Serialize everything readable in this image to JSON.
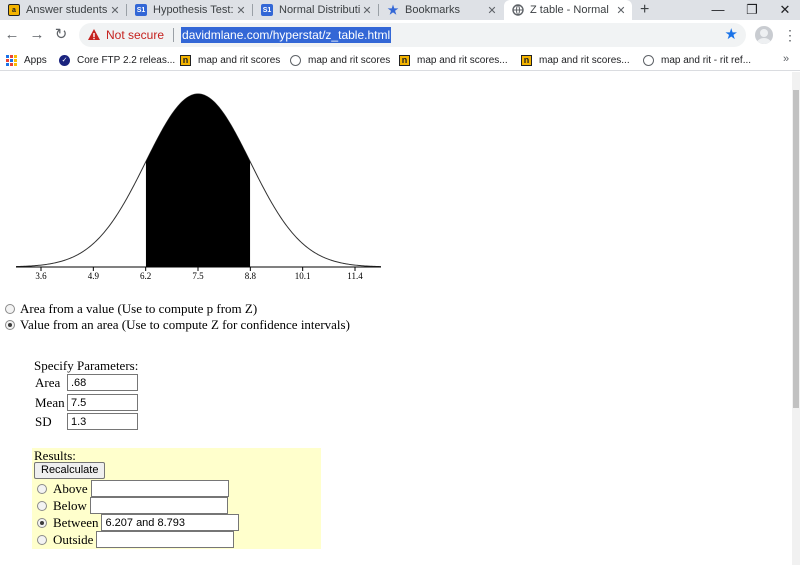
{
  "tabs": [
    {
      "label": "Answer students'",
      "favicon": "answer-favicon",
      "active": false
    },
    {
      "label": "Hypothesis Test: D",
      "favicon": "st-favicon",
      "active": false
    },
    {
      "label": "Normal Distributi",
      "favicon": "st-favicon",
      "active": false
    },
    {
      "label": "Bookmarks",
      "favicon": "star-favicon",
      "active": false
    },
    {
      "label": "Z table - Normal",
      "favicon": "globe-favicon",
      "active": true
    }
  ],
  "toolbar": {
    "security_label": "Not secure",
    "url": "davidmlane.com/hyperstat/z_table.html"
  },
  "bookmarks": [
    {
      "label": "Apps",
      "icon": "apps-icon"
    },
    {
      "label": "Core FTP 2.2 releas...",
      "icon": "ftp-icon"
    },
    {
      "label": "map and rit scores",
      "icon": "n-icon"
    },
    {
      "label": "map and rit scores",
      "icon": "globe-icon"
    },
    {
      "label": "map and rit scores...",
      "icon": "n-icon"
    },
    {
      "label": "map and rit scores...",
      "icon": "n-icon"
    },
    {
      "label": "map and rit - rit ref...",
      "icon": "globe-icon"
    }
  ],
  "chart_data": {
    "type": "area",
    "distribution": "normal",
    "mean": 7.5,
    "sd": 1.3,
    "shaded_region": [
      6.207,
      8.793
    ],
    "x_ticks": [
      "3.6",
      "4.9",
      "6.2",
      "7.5",
      "8.8",
      "10.1",
      "11.4"
    ],
    "x_tick_values": [
      3.6,
      4.9,
      6.2,
      7.5,
      8.8,
      10.1,
      11.4
    ],
    "xlim": [
      3.3,
      12.0
    ],
    "title": "",
    "xlabel": "",
    "ylabel": ""
  },
  "mode": {
    "options": [
      {
        "label": "Area from a value (Use to compute p from Z)",
        "checked": false
      },
      {
        "label": "Value from an area (Use to compute Z for confidence intervals)",
        "checked": true
      }
    ]
  },
  "parameters": {
    "heading": "Specify Parameters:",
    "area_label": "Area",
    "area_value": ".68",
    "mean_label": "Mean",
    "mean_value": "7.5",
    "sd_label": "SD",
    "sd_value": "1.3"
  },
  "results": {
    "heading": "Results:",
    "recalculate_label": "Recalculate",
    "options": [
      {
        "label": "Above",
        "value": "",
        "checked": false
      },
      {
        "label": "Below",
        "value": "",
        "checked": false
      },
      {
        "label": "Between",
        "value": "6.207 and 8.793",
        "checked": true
      },
      {
        "label": "Outside",
        "value": "",
        "checked": false
      }
    ]
  }
}
